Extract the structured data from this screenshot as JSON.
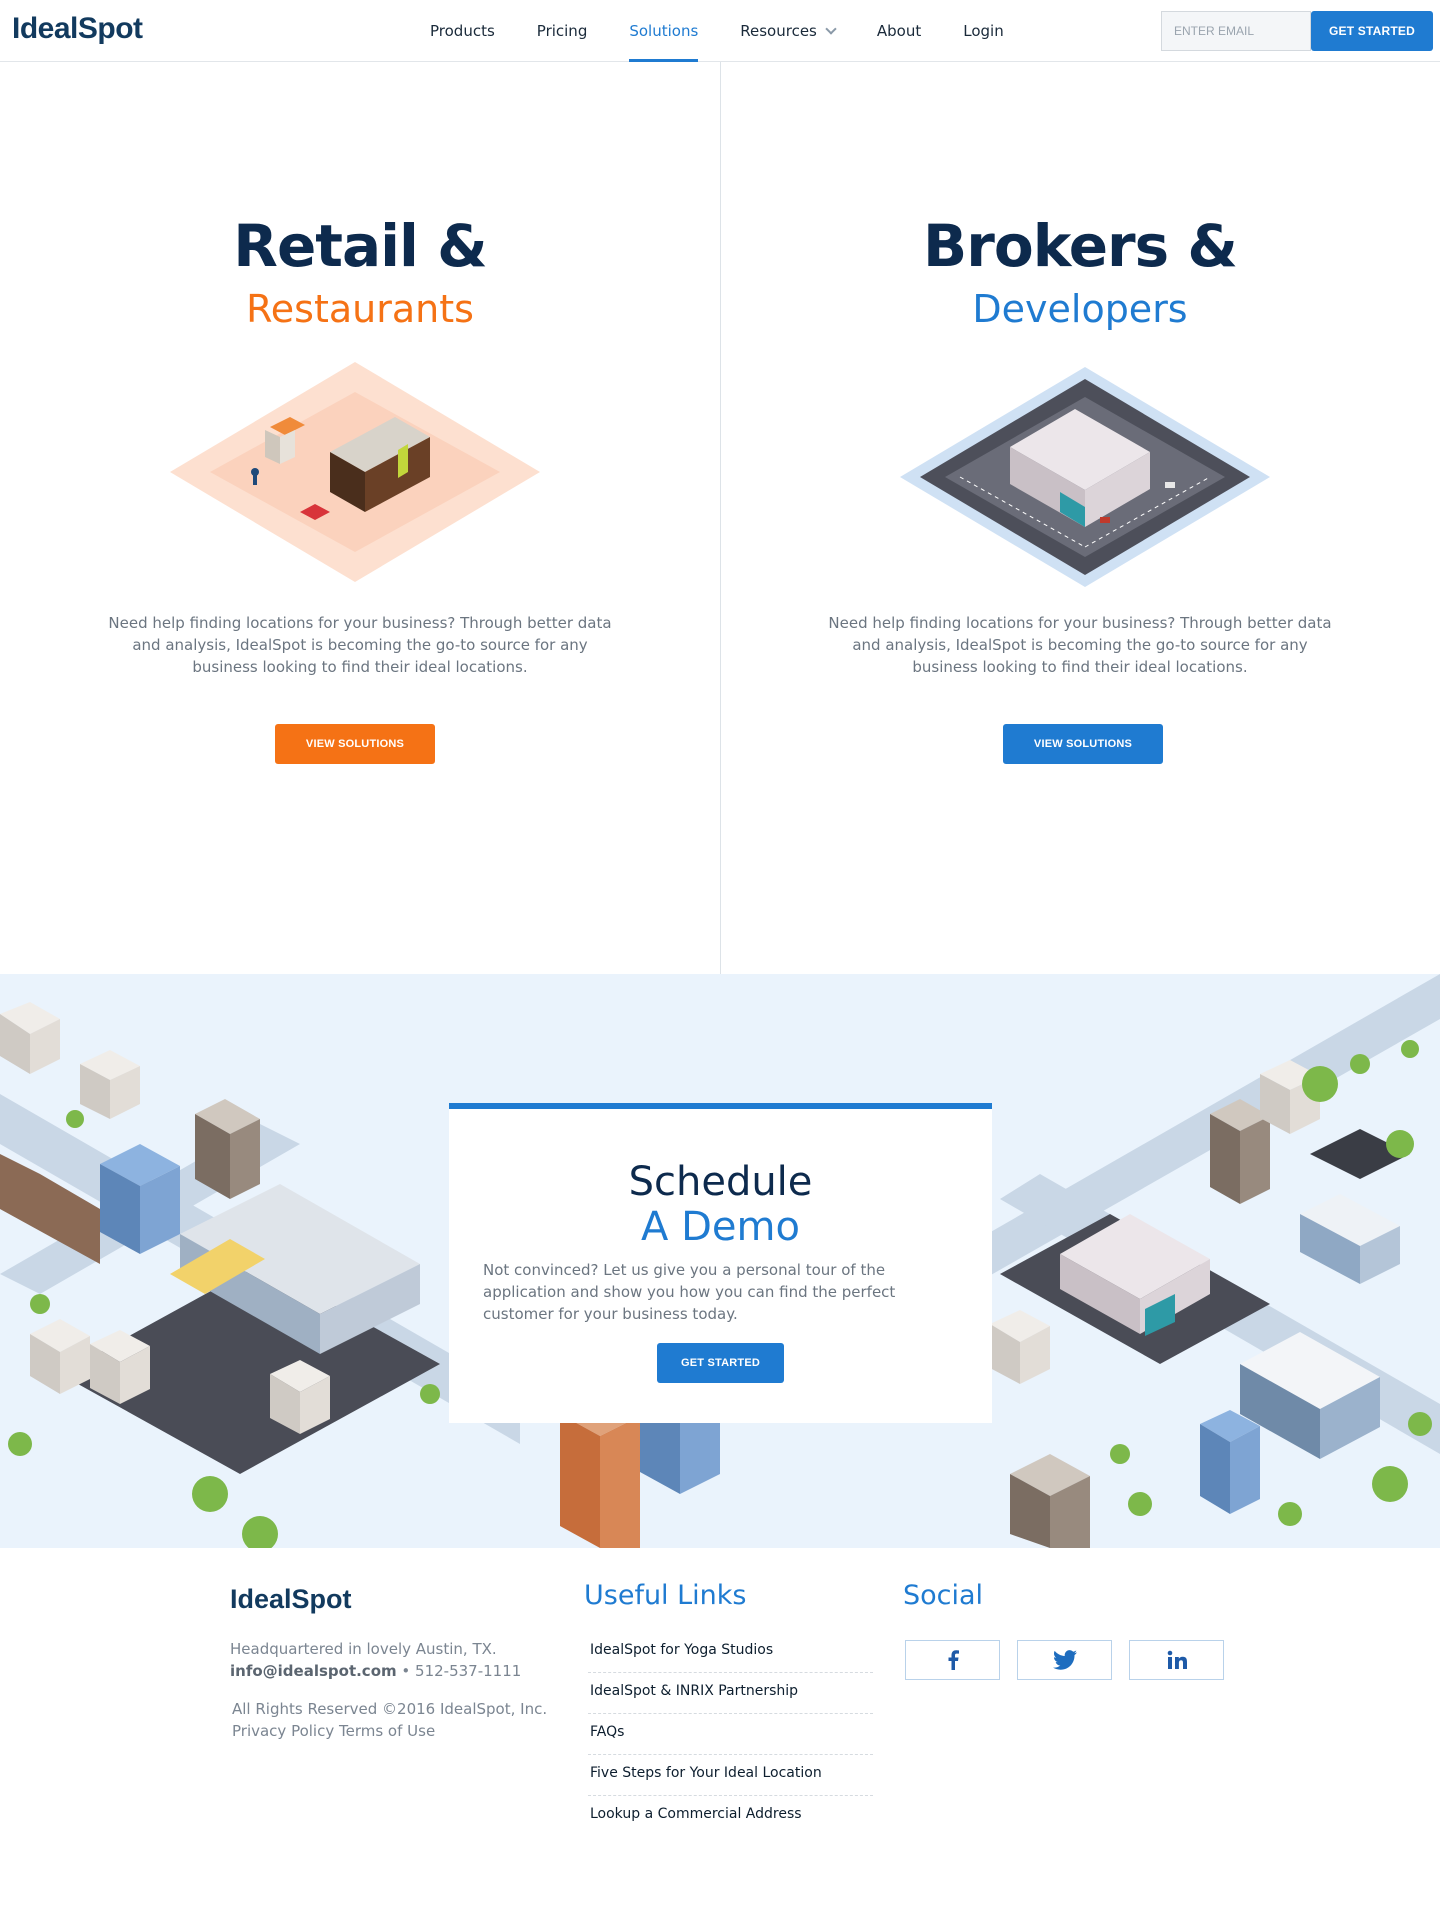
{
  "nav": {
    "logo": "IdealSpot",
    "links": [
      "Products",
      "Pricing",
      "Solutions",
      "Resources",
      "About",
      "Login"
    ],
    "active": "Solutions",
    "email_placeholder": "ENTER EMAIL",
    "cta": "GET STARTED"
  },
  "retail": {
    "title": "Retail &",
    "subtitle": "Restaurants",
    "accent": "#f57215",
    "description": "Need help finding locations for your business? Through better data and analysis, IdealSpot is becoming the go-to source for any business looking to find their ideal locations.",
    "button": "VIEW SOLUTIONS"
  },
  "brokers": {
    "title": "Brokers &",
    "subtitle": "Developers",
    "accent": "#1f7bd1",
    "description": "Need help finding locations for your business? Through better data and analysis, IdealSpot is becoming the go-to source for any business looking to find their ideal locations.",
    "button": "VIEW SOLUTIONS"
  },
  "demo": {
    "title1": "Schedule",
    "title2": "A Demo",
    "text": "Not convinced? Let us give you a personal tour of the application and show you how you can find the perfect customer for your business today.",
    "button": "GET STARTED"
  },
  "footer": {
    "logo": "IdealSpot",
    "hq": "Headquartered in lovely Austin, TX.",
    "email": "info@idealspot.com",
    "phone": "• 512-537-1111",
    "rights": "All Rights Reserved ©2016 IdealSpot, Inc.",
    "policy": "Privacy Policy Terms of Use",
    "useful_title": "Useful Links",
    "links": [
      "IdealSpot for Yoga Studios",
      "IdealSpot & INRIX Partnership",
      "FAQs",
      "Five Steps for Your Ideal Location",
      "Lookup a Commercial Address"
    ],
    "social_title": "Social",
    "social": [
      "facebook-icon",
      "twitter-icon",
      "linkedin-icon"
    ]
  },
  "colors": {
    "primary": "#1f7bd1",
    "orange": "#f57215",
    "navy": "#0d2a4d"
  }
}
